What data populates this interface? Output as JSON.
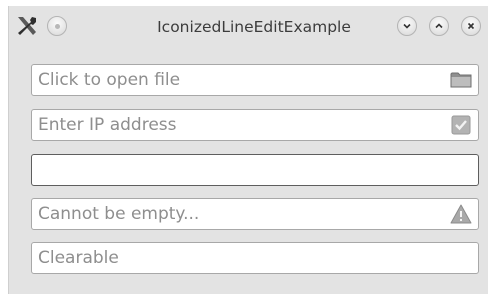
{
  "window": {
    "title": "IconizedLineEditExample",
    "app_icon": "tools-icon",
    "left_buttons": [
      "menu-dot-icon"
    ],
    "right_buttons": [
      "minimize-icon",
      "maximize-icon",
      "close-icon"
    ]
  },
  "fields": [
    {
      "placeholder": "Click to open file",
      "value": "",
      "icon": "folder-icon"
    },
    {
      "placeholder": "Enter IP address",
      "value": "",
      "icon": "checkmark-icon"
    },
    {
      "placeholder": "",
      "value": "",
      "icon": ""
    },
    {
      "placeholder": "Cannot be empty...",
      "value": "",
      "icon": "warning-icon"
    },
    {
      "placeholder": "Clearable",
      "value": "",
      "icon": ""
    }
  ]
}
